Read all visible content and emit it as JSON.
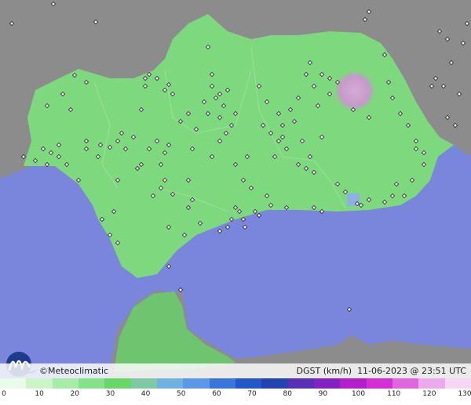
{
  "credit": {
    "brand": "©Meteoclimatic",
    "variable": "DGST (km/h)",
    "datetime": "11-06-2023 @ 23:51 UTC"
  },
  "legend": {
    "ticks": [
      "0",
      "10",
      "20",
      "30",
      "40",
      "50",
      "60",
      "70",
      "80",
      "90",
      "100",
      "110",
      "120",
      "130"
    ],
    "colors": [
      "#e9fbe9",
      "#c9f5c9",
      "#a7eda7",
      "#86e286",
      "#67d767",
      "#7ec8a6",
      "#6fb2e0",
      "#5c97e8",
      "#3a75db",
      "#2358c8",
      "#2244b3",
      "#5a2fb8",
      "#8322c4",
      "#b41fcc",
      "#d42fd4",
      "#e066e0",
      "#ecaaec",
      "#f5d6f5"
    ]
  },
  "map_layers": {
    "land_color": "#8a8a8a",
    "sea_color": "#7a86dc",
    "region_color": "#7ed87e",
    "north_africa_color": "#6fc46f",
    "hotspot_color": "#c8a0c8",
    "station_marker": "diamond"
  }
}
